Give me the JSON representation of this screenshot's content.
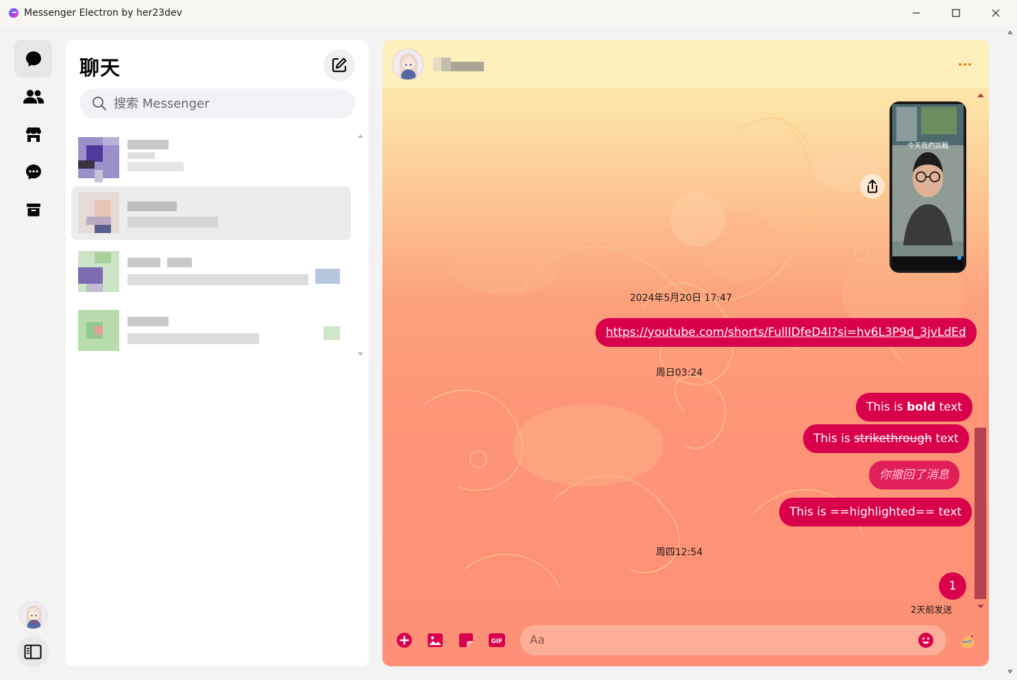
{
  "window": {
    "title": "Messenger Electron by her23dev"
  },
  "rail": {
    "items": [
      {
        "icon": "chat-bubble-icon",
        "active": true
      },
      {
        "icon": "people-icon",
        "active": false
      },
      {
        "icon": "marketplace-icon",
        "active": false
      },
      {
        "icon": "message-requests-icon",
        "active": false
      },
      {
        "icon": "archive-icon",
        "active": false
      }
    ]
  },
  "list": {
    "title": "聊天",
    "search_placeholder": "搜索 Messenger"
  },
  "chat": {
    "messages": {
      "timestamp_1": "2024年5月20日 17:47",
      "link": "https://youtube.com/shorts/FullIDfeD4I?si=hv6L3P9d_3jvLdEd",
      "timestamp_2": "周日03:24",
      "bold_prefix": "This is ",
      "bold_word": "bold",
      "bold_suffix": " text",
      "strike_prefix": "This is ",
      "strike_word": "strikethrough",
      "strike_suffix": " text",
      "unsent": "你撤回了消息",
      "highlighted": "This is ==highlighted== text",
      "timestamp_3": "周四12:54",
      "last": "1",
      "sent_status": "2天前发送"
    },
    "video_caption": "今天我們挑戰",
    "composer_placeholder": "Aa",
    "colors": {
      "bubble": "#d9004c",
      "accent": "#ff7a1a"
    }
  }
}
